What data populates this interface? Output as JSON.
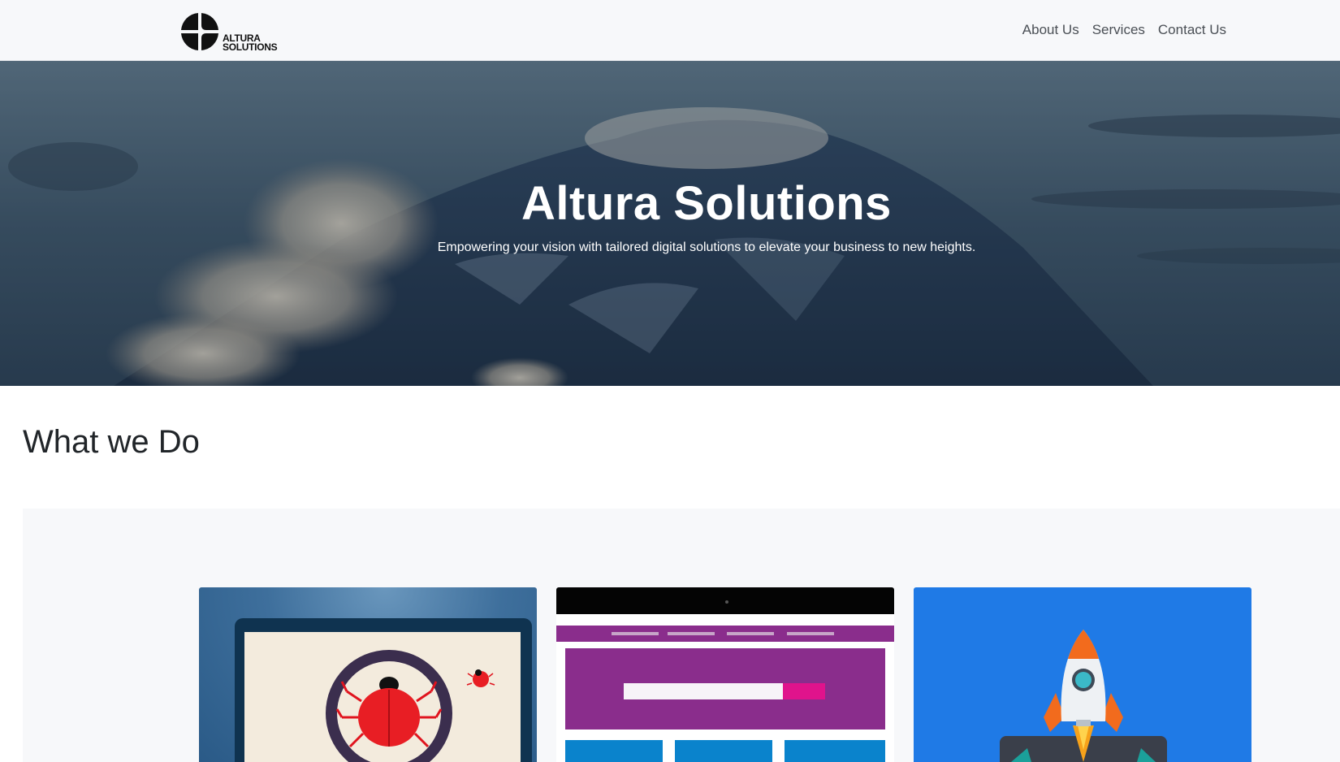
{
  "brand": {
    "logo_line1": "ALTURA",
    "logo_line2": "SOLUTIONS"
  },
  "nav": {
    "items": [
      "About Us",
      "Services",
      "Contact Us"
    ]
  },
  "hero": {
    "title": "Altura Solutions",
    "subtitle": "Empowering your vision with tailored digital solutions to elevate your business to new heights."
  },
  "section": {
    "title": "What we Do"
  },
  "cards": [
    {
      "icon": "bug-magnifier-icon"
    },
    {
      "icon": "website-mockup-icon"
    },
    {
      "icon": "rocket-launch-icon"
    }
  ],
  "colors": {
    "navbar_bg": "#f7f8fa",
    "hero_overlay": "#24374a",
    "card1_bg": "#3e6f9c",
    "card2_accent": "#8a2d8c",
    "card3_bg": "#1f7ae6"
  }
}
